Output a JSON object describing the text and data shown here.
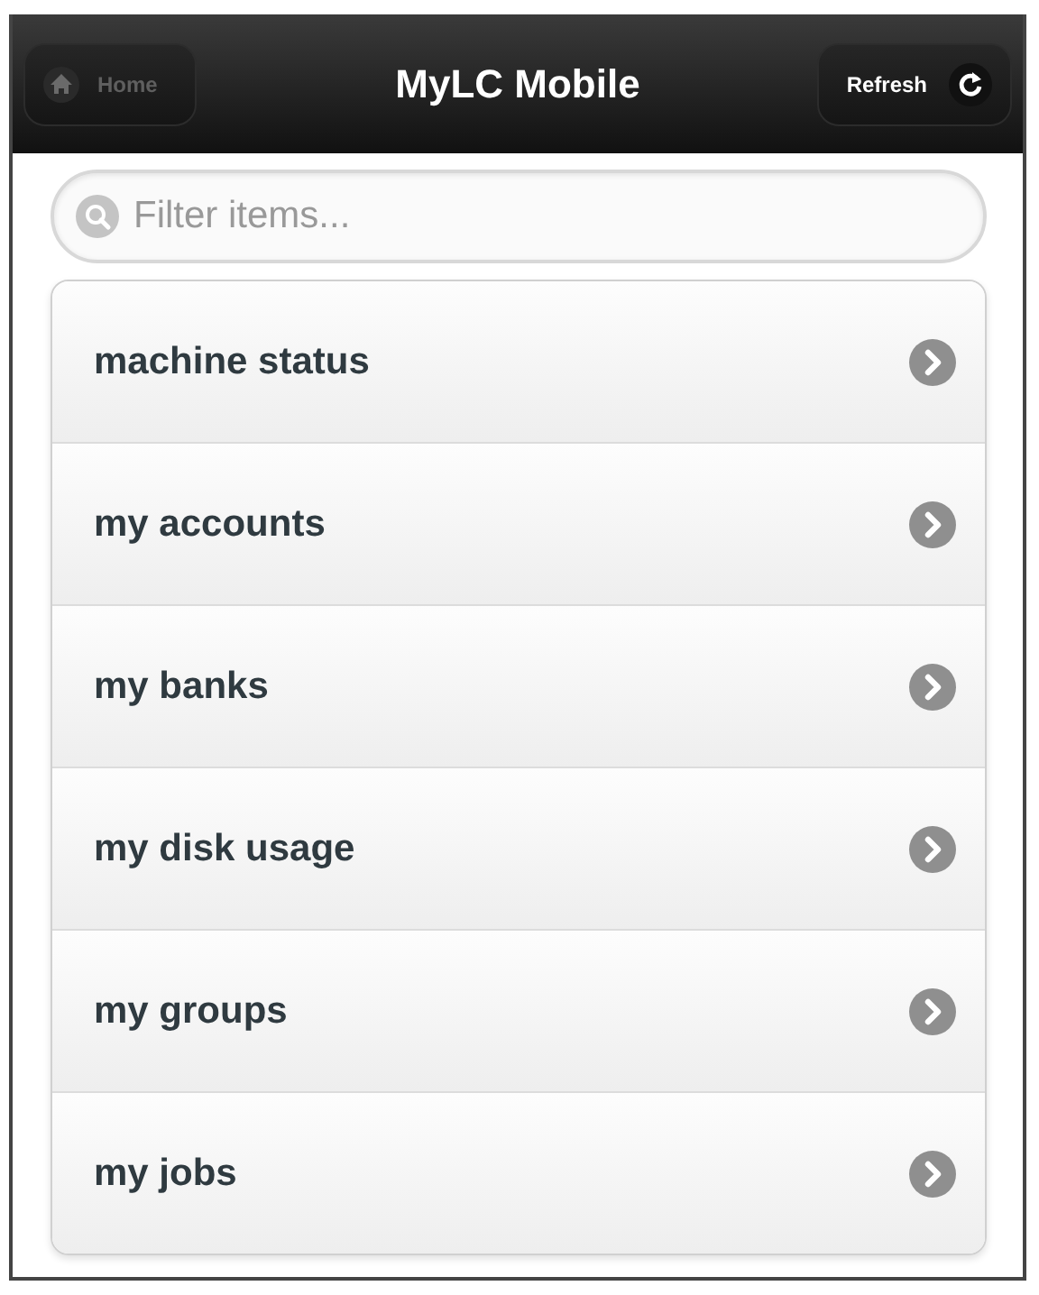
{
  "header": {
    "home_button": "Home",
    "title": "MyLC Mobile",
    "refresh_button": "Refresh"
  },
  "filter": {
    "placeholder": "Filter items..."
  },
  "items": [
    {
      "label": "machine status"
    },
    {
      "label": "my accounts"
    },
    {
      "label": "my banks"
    },
    {
      "label": "my disk usage"
    },
    {
      "label": "my groups"
    },
    {
      "label": "my jobs"
    }
  ]
}
